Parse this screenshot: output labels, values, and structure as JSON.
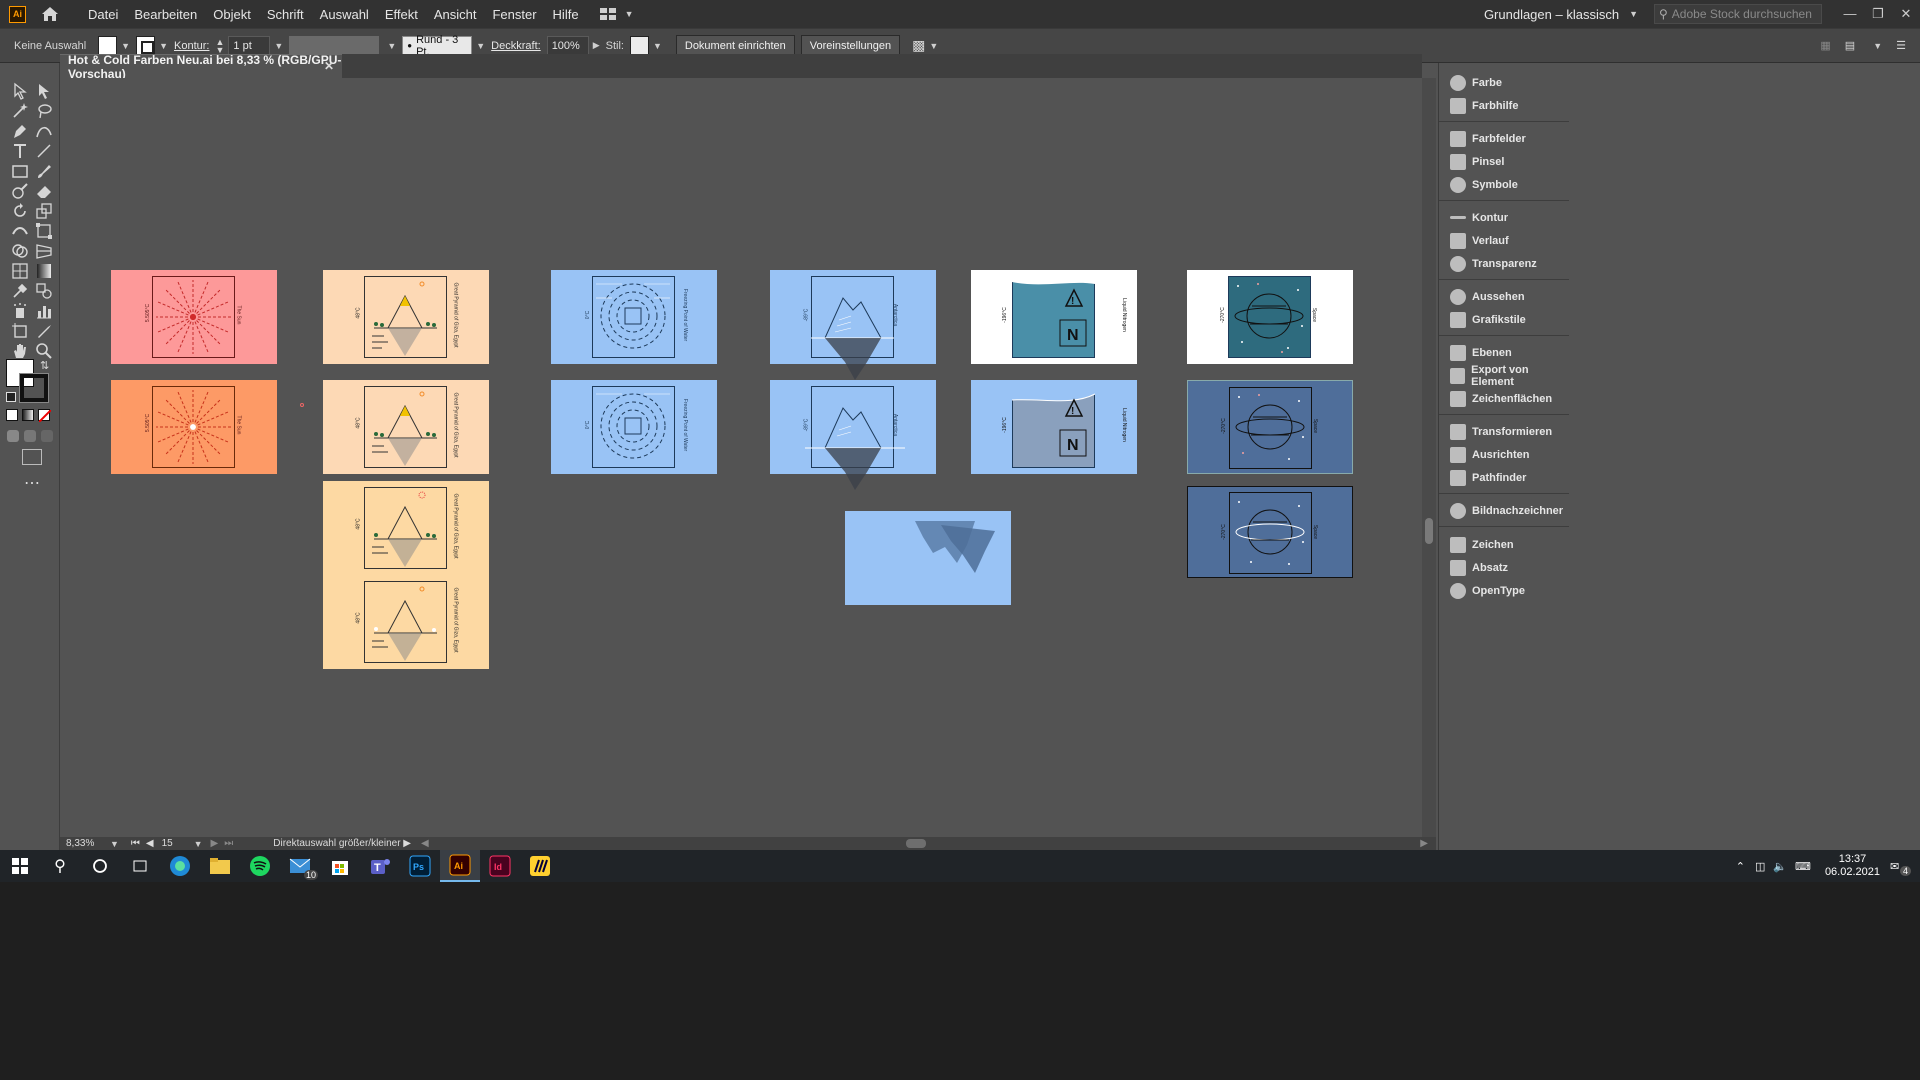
{
  "app": {
    "logo": "Ai",
    "menu": [
      "Datei",
      "Bearbeiten",
      "Objekt",
      "Schrift",
      "Auswahl",
      "Effekt",
      "Ansicht",
      "Fenster",
      "Hilfe"
    ],
    "workspace": "Grundlagen – klassisch",
    "stock_search_placeholder": "Adobe Stock durchsuchen"
  },
  "controlbar": {
    "selection": "Keine Auswahl",
    "kontur_label": "Kontur:",
    "kontur_value": "1 pt",
    "brush": "Rund - 3 Pt.",
    "deckkraft_label": "Deckkraft:",
    "deckkraft_value": "100%",
    "stil_label": "Stil:",
    "doc_setup": "Dokument einrichten",
    "prefs": "Voreinstellungen"
  },
  "document": {
    "tab_title": "Hot & Cold Farben Neu.ai bei 8,33 % (RGB/GPU-Vorschau)"
  },
  "artboards": {
    "sun_temp": "5.505°C",
    "sun_label": "The Sun",
    "pyramid_temp": "48°C",
    "pyramid_label": "Great Pyramid of Giza, Egypt",
    "water_temp": "0°C",
    "water_label": "Freezing Point of Water",
    "ice_temp": "-89°C",
    "ice_label": "Antarctica",
    "n2_temp": "-196°C",
    "n2_label": "Liquid Nitrogen",
    "n2_letter": "N",
    "space_temp": "-270°C",
    "space_label": "Space"
  },
  "statusbar": {
    "zoom": "8,33%",
    "artboard_no": "15",
    "hint": "Direktauswahl größer/kleiner"
  },
  "panels": [
    "Farbe",
    "Farbhilfe",
    "Farbfelder",
    "Pinsel",
    "Symbole",
    "Kontur",
    "Verlauf",
    "Transparenz",
    "Aussehen",
    "Grafikstile",
    "Ebenen",
    "Export von Element",
    "Zeichenflächen",
    "Transformieren",
    "Ausrichten",
    "Pathfinder",
    "Bildnachzeichner",
    "Zeichen",
    "Absatz",
    "OpenType"
  ],
  "taskbar": {
    "mail_badge": "10",
    "time": "13:37",
    "date": "06.02.2021",
    "notif": "4"
  },
  "colors": {
    "sun_pink": "#fd9999",
    "sun_orange": "#fd9a66",
    "peach": "#fdd9b5",
    "light_orange": "#fdd9a3",
    "ice_blue": "#99c3f5",
    "space_teal": "#2e6b7e",
    "space_blue": "#4f6e9a"
  }
}
